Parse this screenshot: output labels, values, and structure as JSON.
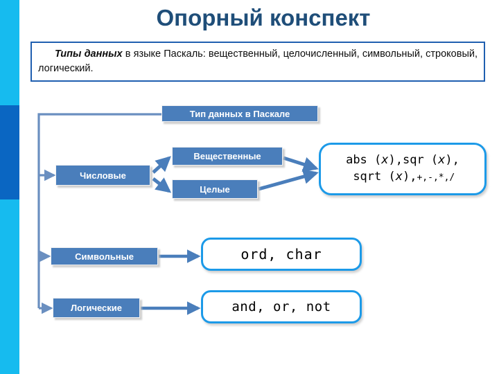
{
  "slide": {
    "title": "Опорный конспект",
    "title_color": "#1f4e79"
  },
  "definition": {
    "lead": "Типы данных",
    "rest": " в языке Паскаль: вещественный, целочисленный, символьный, строковый, логический.",
    "border_color": "#1f5fb0"
  },
  "decor": {
    "cyan_color": "#16bbef",
    "dark_blue_color": "#0a66c2"
  },
  "diagram": {
    "node_fill": "#4a7ebb",
    "connector_color": "#4a7ebb",
    "callout_border": "#1c9ae8",
    "nodes": {
      "root": "Тип данных в Паскале",
      "numeric": "Числовые",
      "real": "Вещественные",
      "integer": "Целые",
      "character": "Символьные",
      "logical": "Логические"
    },
    "callouts": {
      "arith_line1": "abs (x),sqr (x),",
      "arith_line1_pre": "abs (",
      "arith_line1_var1": "x",
      "arith_line1_mid": "),sqr (",
      "arith_line1_var2": "x",
      "arith_line1_end": "),",
      "arith_line2_pre": " sqrt (",
      "arith_line2_var": "x",
      "arith_line2_end": "),",
      "arith_ops": "+,-,*,/",
      "ordinal": "ord, char",
      "logical": "and, or, not"
    }
  }
}
